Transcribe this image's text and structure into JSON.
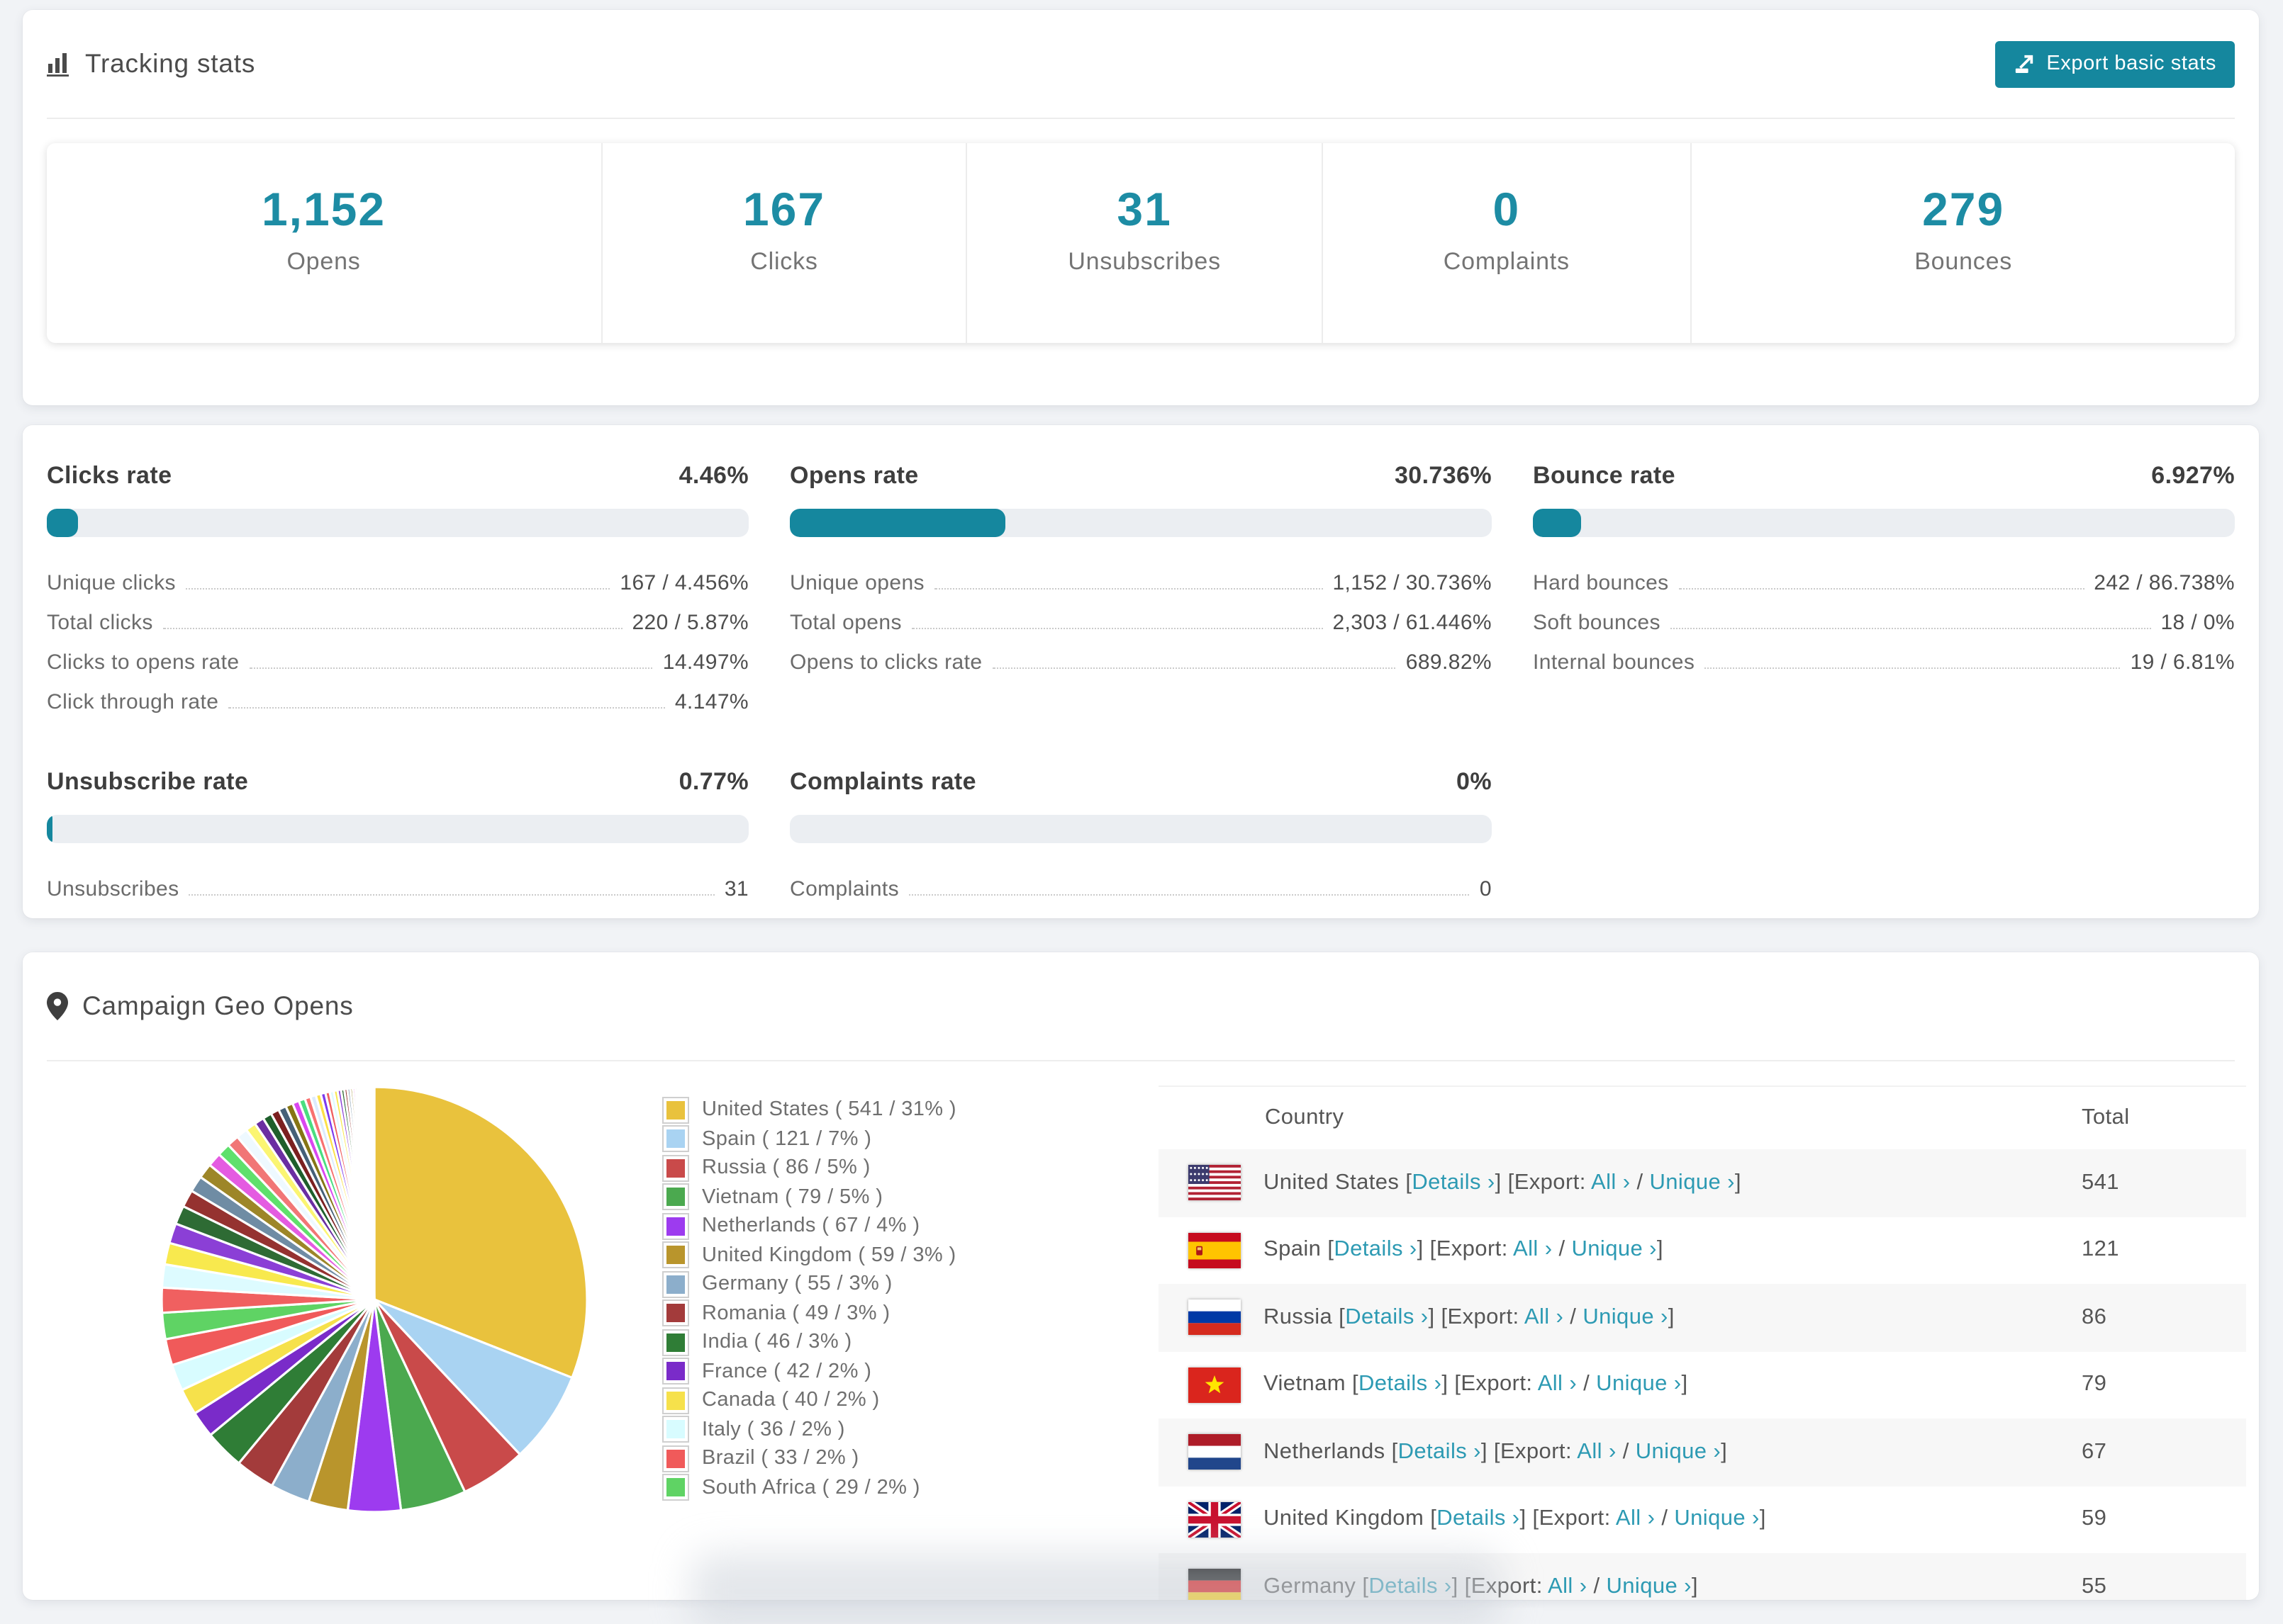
{
  "header": {
    "title": "Tracking stats",
    "export_button": "Export basic stats"
  },
  "summary_stats": [
    {
      "value": "1,152",
      "label": "Opens"
    },
    {
      "value": "167",
      "label": "Clicks"
    },
    {
      "value": "31",
      "label": "Unsubscribes"
    },
    {
      "value": "0",
      "label": "Complaints"
    },
    {
      "value": "279",
      "label": "Bounces"
    }
  ],
  "rates": [
    {
      "title": "Clicks rate",
      "value": "4.46%",
      "pct": 4.46,
      "rows": [
        {
          "label": "Unique clicks",
          "value": "167 / 4.456%"
        },
        {
          "label": "Total clicks",
          "value": "220 / 5.87%"
        },
        {
          "label": "Clicks to opens rate",
          "value": "14.497%"
        },
        {
          "label": "Click through rate",
          "value": "4.147%"
        }
      ]
    },
    {
      "title": "Opens rate",
      "value": "30.736%",
      "pct": 30.736,
      "rows": [
        {
          "label": "Unique opens",
          "value": "1,152 / 30.736%"
        },
        {
          "label": "Total opens",
          "value": "2,303 / 61.446%"
        },
        {
          "label": "Opens to clicks rate",
          "value": "689.82%"
        }
      ]
    },
    {
      "title": "Bounce rate",
      "value": "6.927%",
      "pct": 6.927,
      "rows": [
        {
          "label": "Hard bounces",
          "value": "242 / 86.738%"
        },
        {
          "label": "Soft bounces",
          "value": "18 / 0%"
        },
        {
          "label": "Internal bounces",
          "value": "19 / 6.81%"
        }
      ]
    },
    {
      "title": "Unsubscribe rate",
      "value": "0.77%",
      "pct": 0.77,
      "rows": [
        {
          "label": "Unsubscribes",
          "value": "31"
        }
      ]
    },
    {
      "title": "Complaints rate",
      "value": "0%",
      "pct": 0,
      "rows": [
        {
          "label": "Complaints",
          "value": "0"
        }
      ]
    }
  ],
  "geo": {
    "title": "Campaign Geo Opens",
    "table": {
      "columns": [
        "Country",
        "Total"
      ],
      "link_parts": {
        "pre": " [",
        "details": "Details ›",
        "between": "] [Export: ",
        "all": "All ›",
        "divider": " / ",
        "unique": "Unique ›",
        "post": "]"
      },
      "rows": [
        {
          "country": "United States",
          "code": "us",
          "total": "541"
        },
        {
          "country": "Spain",
          "code": "es",
          "total": "121"
        },
        {
          "country": "Russia",
          "code": "ru",
          "total": "86"
        },
        {
          "country": "Vietnam",
          "code": "vn",
          "total": "79"
        },
        {
          "country": "Netherlands",
          "code": "nl",
          "total": "67"
        },
        {
          "country": "United Kingdom",
          "code": "gb",
          "total": "59"
        },
        {
          "country": "Germany",
          "code": "de",
          "total": "55"
        }
      ]
    }
  },
  "chart_data": {
    "type": "pie",
    "title": "Campaign Geo Opens",
    "legend_position": "right",
    "start_angle_deg": -90,
    "direction": "clockwise",
    "series": [
      {
        "label": "United States",
        "value": 541,
        "pct": 31,
        "color": "#E9C23D",
        "legend": "United States ( 541 / 31% )"
      },
      {
        "label": "Spain",
        "value": 121,
        "pct": 7,
        "color": "#A9D3F2",
        "legend": "Spain ( 121 / 7% )"
      },
      {
        "label": "Russia",
        "value": 86,
        "pct": 5,
        "color": "#C94A4A",
        "legend": "Russia ( 86 / 5% )"
      },
      {
        "label": "Vietnam",
        "value": 79,
        "pct": 5,
        "color": "#4BA94F",
        "legend": "Vietnam ( 79 / 5% )"
      },
      {
        "label": "Netherlands",
        "value": 67,
        "pct": 4,
        "color": "#9D3BEF",
        "legend": "Netherlands ( 67 / 4% )"
      },
      {
        "label": "United Kingdom",
        "value": 59,
        "pct": 3,
        "color": "#B9952C",
        "legend": "United Kingdom ( 59 / 3% )"
      },
      {
        "label": "Germany",
        "value": 55,
        "pct": 3,
        "color": "#8CAECB",
        "legend": "Germany ( 55 / 3% )"
      },
      {
        "label": "Romania",
        "value": 49,
        "pct": 3,
        "color": "#A33B3B",
        "legend": "Romania ( 49 / 3% )"
      },
      {
        "label": "India",
        "value": 46,
        "pct": 3,
        "color": "#2F7D36",
        "legend": "India ( 46 / 3% )"
      },
      {
        "label": "France",
        "value": 42,
        "pct": 2,
        "color": "#7A2BC9",
        "legend": "France ( 42 / 2% )"
      },
      {
        "label": "Canada",
        "value": 40,
        "pct": 2,
        "color": "#F6E14B",
        "legend": "Canada ( 40 / 2% )"
      },
      {
        "label": "Italy",
        "value": 36,
        "pct": 2,
        "color": "#D8FCFF",
        "legend": "Italy ( 36 / 2% )"
      },
      {
        "label": "Brazil",
        "value": 33,
        "pct": 2,
        "color": "#F05A5A",
        "legend": "Brazil ( 33 / 2% )"
      },
      {
        "label": "South Africa",
        "value": 29,
        "pct": 2,
        "color": "#5FD364",
        "legend": "South Africa ( 29 / 2% )"
      }
    ],
    "others": {
      "note": "remaining unlabeled small countries",
      "total_pct": 26,
      "count": 45,
      "decay": 0.93,
      "palette": [
        "#F06060",
        "#DDFBFF",
        "#F8E94E",
        "#8B3FD6",
        "#2E6B34",
        "#953230",
        "#6F8CA4",
        "#9D8628",
        "#E45BE1",
        "#5FE06C",
        "#F17676",
        "#EEF9FF",
        "#FBF572",
        "#6B2EA1",
        "#1E5F2B",
        "#7B2020",
        "#456078",
        "#867515",
        "#DA47F0",
        "#4ADE80",
        "#F87171",
        "#DCEBFD",
        "#FDE047",
        "#7C3AED"
      ]
    }
  }
}
